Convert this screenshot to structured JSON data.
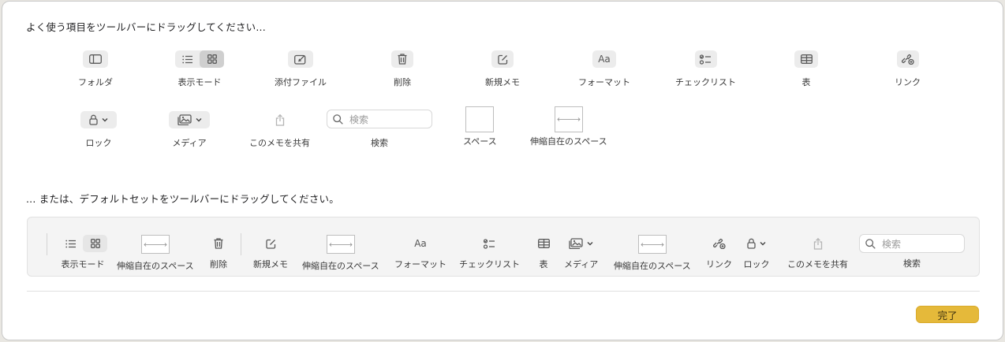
{
  "palette_heading": "よく使う項目をツールバーにドラッグしてください...",
  "palette": {
    "row1": [
      {
        "label": "フォルダ",
        "icon": "sidebar-icon"
      },
      {
        "label": "表示モード",
        "icon": "view-mode-icon"
      },
      {
        "label": "添付ファイル",
        "icon": "attachment-icon"
      },
      {
        "label": "削除",
        "icon": "trash-icon"
      },
      {
        "label": "新規メモ",
        "icon": "compose-icon"
      },
      {
        "label": "フォーマット",
        "icon": "format-icon"
      },
      {
        "label": "チェックリスト",
        "icon": "checklist-icon"
      },
      {
        "label": "表",
        "icon": "table-icon"
      },
      {
        "label": "リンク",
        "icon": "link-icon"
      }
    ],
    "row2": [
      {
        "label": "ロック",
        "icon": "lock-icon"
      },
      {
        "label": "メディア",
        "icon": "media-icon"
      },
      {
        "label": "このメモを共有",
        "icon": "share-icon"
      },
      {
        "label": "検索",
        "icon": "search-icon",
        "placeholder": "検索"
      },
      {
        "label": "スペース",
        "icon": "space-icon"
      },
      {
        "label": "伸縮自在のスペース",
        "icon": "flexible-space-icon"
      }
    ],
    "format_glyph": "Aa"
  },
  "default_heading": "... または、デフォルトセットをツールバーにドラッグしてください。",
  "default_set": [
    {
      "label": "表示モード"
    },
    {
      "label": "伸縮自在のスペース"
    },
    {
      "label": "削除"
    },
    {
      "label": "新規メモ"
    },
    {
      "label": "伸縮自在のスペース"
    },
    {
      "label": "フォーマット"
    },
    {
      "label": "チェックリスト"
    },
    {
      "label": "表"
    },
    {
      "label": "メディア"
    },
    {
      "label": "伸縮自在のスペース"
    },
    {
      "label": "リンク"
    },
    {
      "label": "ロック"
    },
    {
      "label": "このメモを共有"
    },
    {
      "label": "検索",
      "placeholder": "検索"
    }
  ],
  "done_button": "完了",
  "colors": {
    "accent": "#e5b93a",
    "sheet": "#ffffff",
    "bar": "#f4f4f4"
  }
}
